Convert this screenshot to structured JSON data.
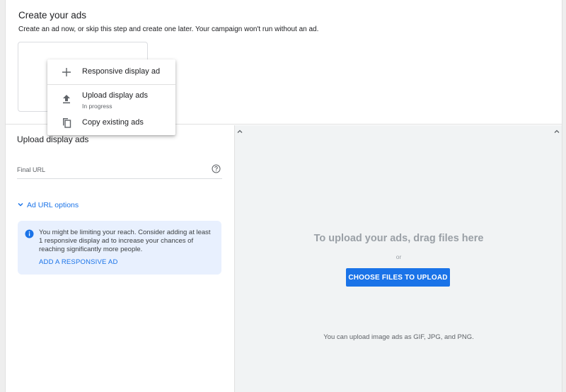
{
  "create_section": {
    "title": "Create your ads",
    "subtitle": "Create an ad now, or skip this step and create one later. Your campaign won't run without an ad."
  },
  "menu": {
    "items": [
      {
        "label": "Responsive display ad",
        "icon": "plus-icon"
      },
      {
        "label": "Upload display ads",
        "sublabel": "In progress",
        "icon": "upload-icon"
      },
      {
        "label": "Copy existing ads",
        "icon": "copy-icon"
      }
    ]
  },
  "upload_panel": {
    "title": "Upload display ads",
    "final_url_label": "Final URL",
    "final_url_value": "",
    "ad_url_options_label": "Ad URL options",
    "info": {
      "text": "You might be limiting your reach. Consider adding at least 1 responsive display ad to increase your chances of reaching significantly more people.",
      "link": "ADD A RESPONSIVE AD"
    }
  },
  "upload_area": {
    "drag_text": "To upload your ads, drag files here",
    "or_text": "or",
    "choose_button": "CHOOSE FILES TO UPLOAD",
    "formats_text": "You can upload image ads as GIF, JPG, and PNG."
  },
  "colors": {
    "accent": "#1a73e8",
    "info_bg": "#e8f0fe",
    "upload_bg": "#f1f3f4"
  }
}
